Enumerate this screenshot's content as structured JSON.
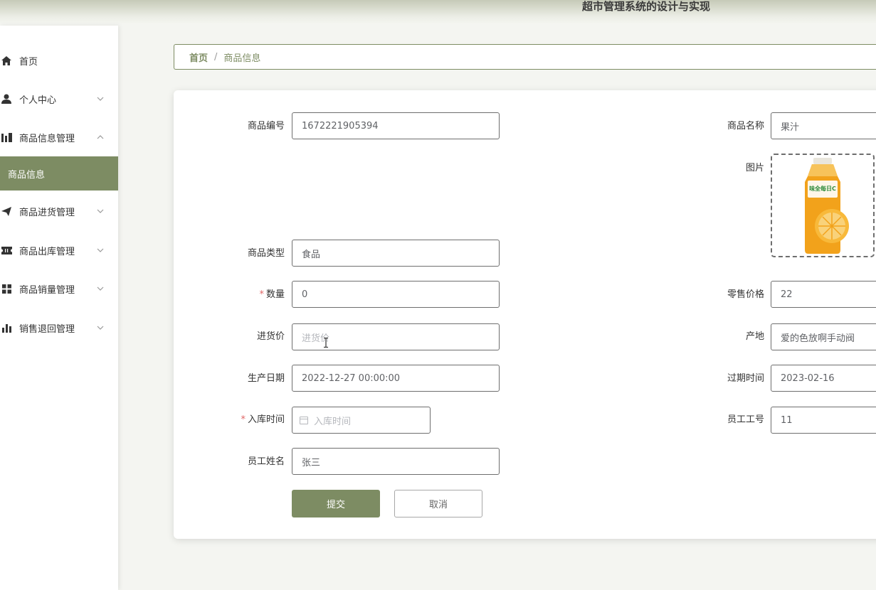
{
  "header": {
    "title": "超市管理系统的设计与实现"
  },
  "sidebar": {
    "items": [
      {
        "label": "首页",
        "icon": "home-icon"
      },
      {
        "label": "个人中心",
        "icon": "user-icon"
      },
      {
        "label": "商品信息管理",
        "icon": "bar-icon"
      },
      {
        "label": "商品进货管理",
        "icon": "send-icon"
      },
      {
        "label": "商品出库管理",
        "icon": "ticket-icon"
      },
      {
        "label": "商品销量管理",
        "icon": "grid-icon"
      },
      {
        "label": "销售退回管理",
        "icon": "chart-icon"
      }
    ],
    "active_sub": "商品信息"
  },
  "breadcrumb": {
    "home": "首页",
    "separator": "/",
    "current": "商品信息"
  },
  "form": {
    "product_id": {
      "label": "商品编号",
      "value": "1672221905394"
    },
    "product_name": {
      "label": "商品名称",
      "value": "果汁"
    },
    "image": {
      "label": "图片"
    },
    "product_type": {
      "label": "商品类型",
      "value": "食品"
    },
    "quantity": {
      "label": "数量",
      "required_mark": "*",
      "value": "0"
    },
    "retail_price": {
      "label": "零售价格",
      "value": "22"
    },
    "purchase_price": {
      "label": "进货价",
      "placeholder": "进货价"
    },
    "origin": {
      "label": "产地",
      "value": "爱的色放啊手动阀"
    },
    "production_date": {
      "label": "生产日期",
      "value": "2022-12-27 00:00:00"
    },
    "expiry_date": {
      "label": "过期时间",
      "value": "2023-02-16"
    },
    "stock_in_time": {
      "label": "入库时间",
      "required_mark": "*",
      "placeholder": "入库时间"
    },
    "employee_id": {
      "label": "员工工号",
      "value": "11"
    },
    "employee_name": {
      "label": "员工姓名",
      "value": "张三"
    },
    "product_image_brand": "味全每日C"
  },
  "buttons": {
    "submit": "提交",
    "cancel": "取消"
  },
  "colors": {
    "accent": "#7d8c63",
    "required": "#e06666",
    "juice_orange": "#f2a21b"
  }
}
